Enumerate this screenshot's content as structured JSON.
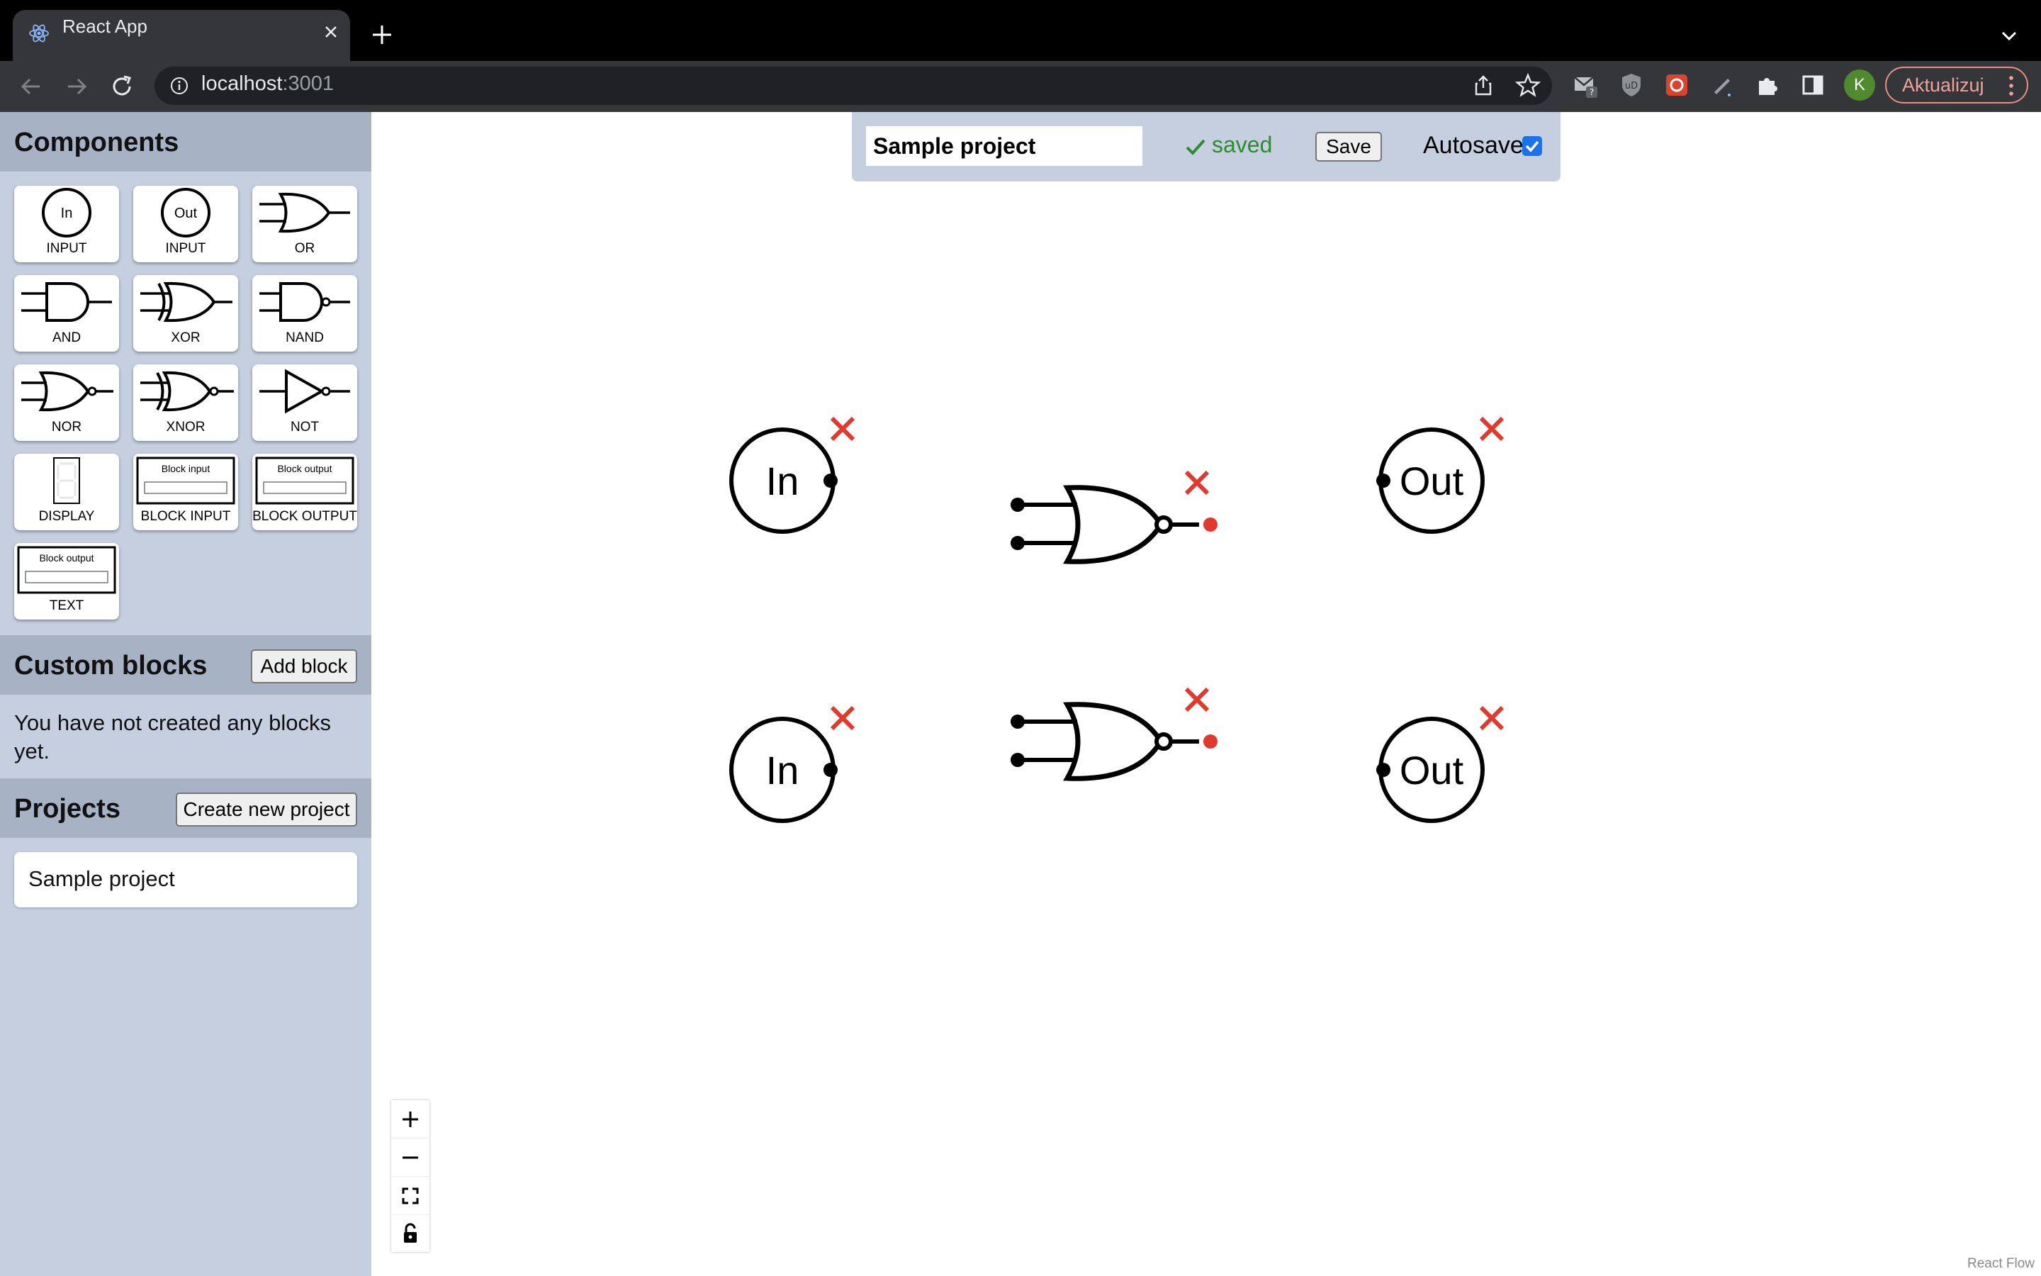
{
  "browser": {
    "tab_title": "React App",
    "url_host": "localhost",
    "url_port": ":3001",
    "update_label": "Aktualizuj",
    "profile_initial": "K"
  },
  "sidebar": {
    "components_title": "Components",
    "components": [
      {
        "label": "INPUT",
        "symbol": "In"
      },
      {
        "label": "INPUT",
        "symbol": "Out"
      },
      {
        "label": "OR"
      },
      {
        "label": "AND"
      },
      {
        "label": "XOR"
      },
      {
        "label": "NAND"
      },
      {
        "label": "NOR"
      },
      {
        "label": "XNOR"
      },
      {
        "label": "NOT"
      },
      {
        "label": "DISPLAY"
      },
      {
        "label": "BLOCK INPUT",
        "preview_text": "Block input"
      },
      {
        "label": "BLOCK OUTPUT",
        "preview_text": "Block output"
      },
      {
        "label": "TEXT",
        "preview_text": "Block output"
      }
    ],
    "custom_blocks_title": "Custom blocks",
    "add_block_label": "Add block",
    "empty_message": "You have not created any blocks yet.",
    "projects_title": "Projects",
    "create_project_label": "Create new project",
    "projects": [
      "Sample project"
    ]
  },
  "project_bar": {
    "name": "Sample project",
    "status": "saved",
    "save_label": "Save",
    "autosave_label": "Autosave",
    "autosave_checked": true
  },
  "canvas": {
    "nodes": [
      {
        "type": "input",
        "label": "In"
      },
      {
        "type": "nor-gate"
      },
      {
        "type": "output",
        "label": "Out"
      },
      {
        "type": "input",
        "label": "In"
      },
      {
        "type": "nor-gate"
      },
      {
        "type": "output",
        "label": "Out"
      }
    ],
    "attribution": "React Flow"
  },
  "colors": {
    "sidebar_bg": "#c5cfe0",
    "section_header_bg": "#a7b2c4",
    "delete_red": "#e03a2f",
    "saved_green": "#2e8b2e",
    "output_handle_red": "#e03a2f"
  }
}
